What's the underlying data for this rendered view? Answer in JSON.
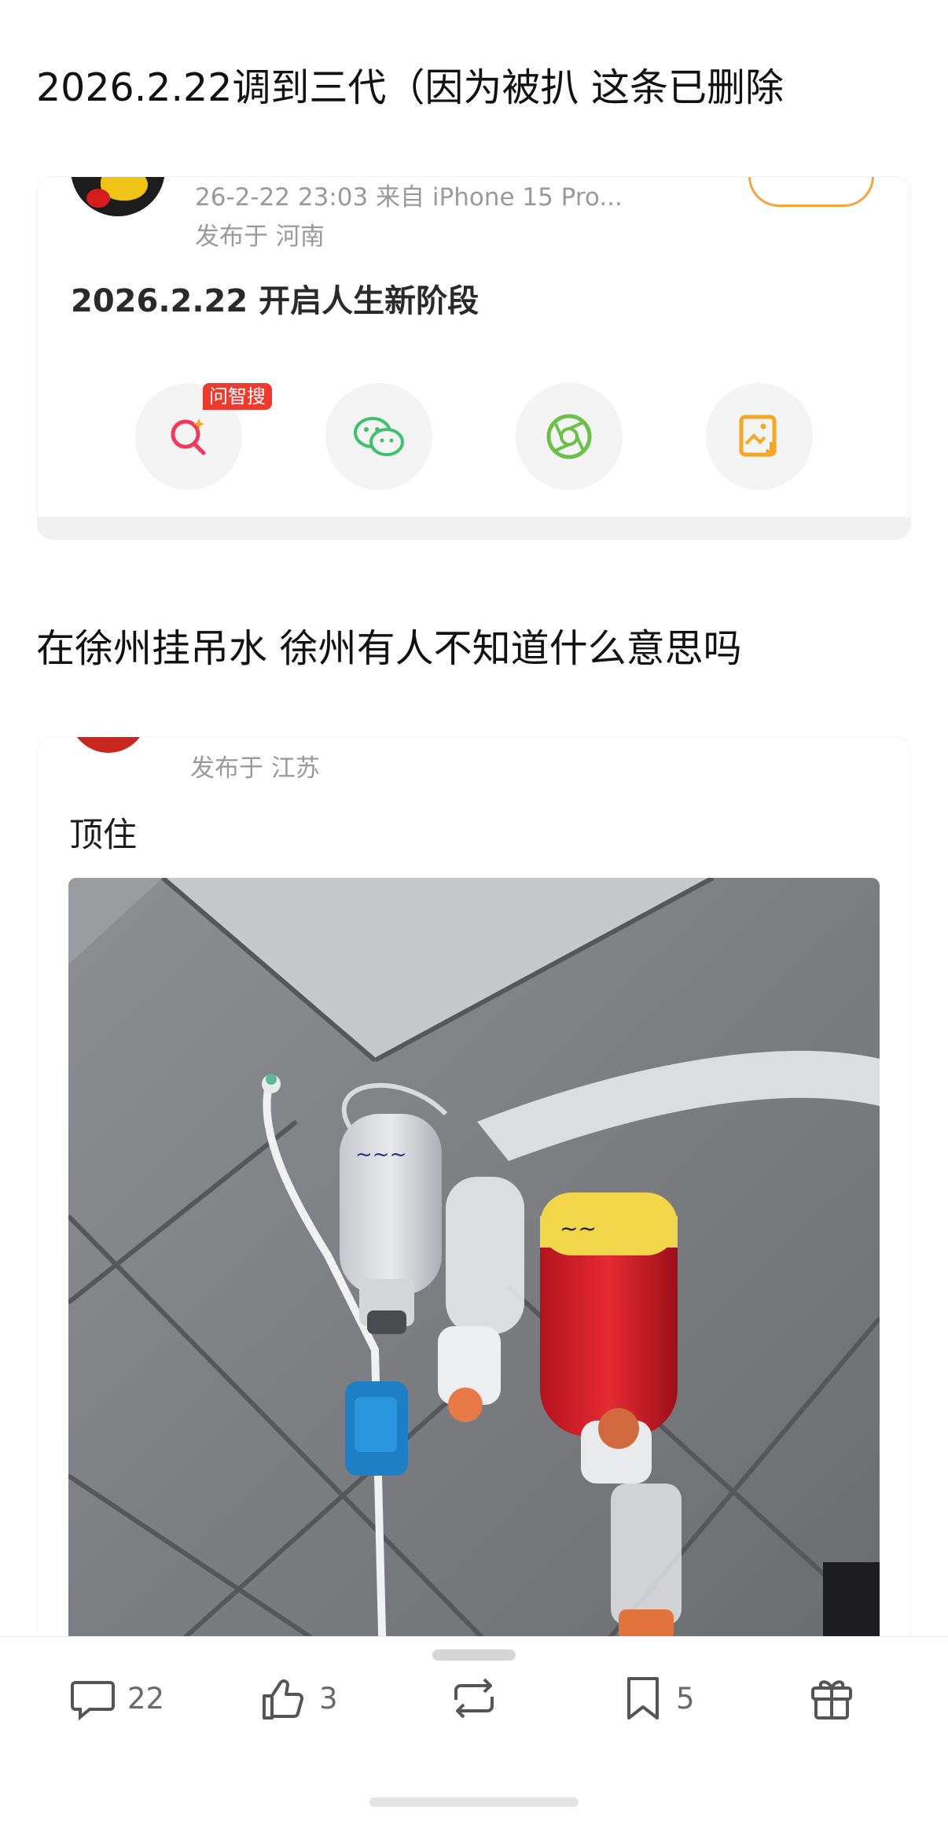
{
  "headings": {
    "first": "2026.2.22调到三代（因为被扒 这条已删除",
    "second": "在徐州挂吊水  徐州有人不知道什么意思吗"
  },
  "post1": {
    "meta": "26-2-22 23:03  来自 iPhone 15 Pro...",
    "location": "发布于 河南",
    "text": "2026.2.22 开启人生新阶段",
    "ai_badge": "问智搜",
    "share_buttons": [
      "search-ai-icon",
      "wechat-icon",
      "moments-icon",
      "save-image-icon"
    ],
    "colors": {
      "ai": "#ef3b2d",
      "wechat": "#3cc26b",
      "moments": "#6cc04a",
      "save": "#f5a623"
    }
  },
  "post2": {
    "location": "发布于 江苏",
    "text": "顶住"
  },
  "actions": {
    "comment_count": "22",
    "like_count": "3",
    "collect_count": "5"
  }
}
